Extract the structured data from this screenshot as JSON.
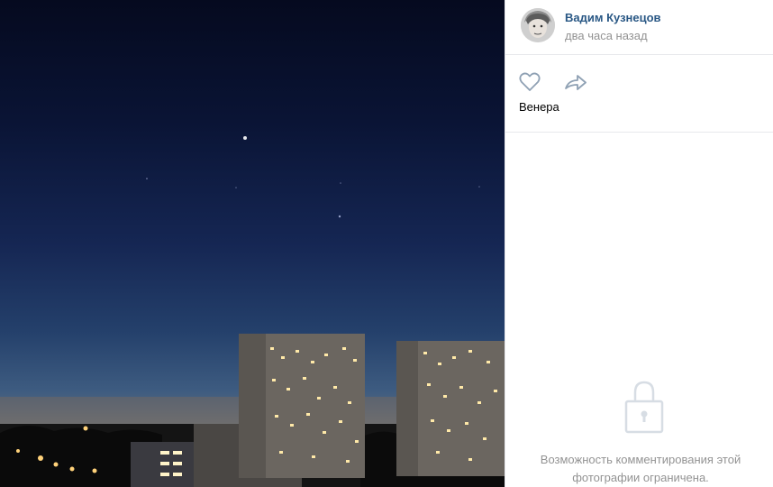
{
  "photo": {
    "subject": "night-sky-city-buildings"
  },
  "post": {
    "author_name": "Вадим Кузнецов",
    "time": "два часа назад",
    "caption": "Венера"
  },
  "comments": {
    "restricted_line1": "Возможность комментирования этой",
    "restricted_line2": "фотографии ограничена."
  },
  "colors": {
    "link": "#2a5885",
    "muted": "#939393",
    "divider": "#e7e8ec"
  },
  "icons": {
    "like": "heart-icon",
    "share": "share-arrow-icon",
    "lock": "lock-icon"
  }
}
